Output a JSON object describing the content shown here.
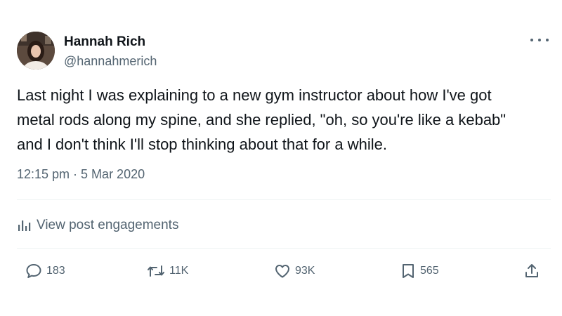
{
  "author": {
    "display_name": "Hannah Rich",
    "handle": "@hannahmerich"
  },
  "tweet": {
    "text_lines": [
      "Last night I was explaining to a new gym instructor about how I've got",
      "metal rods along my spine, and she replied, \"oh, so you're like a kebab\"",
      "and I don't think I'll stop thinking about that for a while."
    ],
    "timestamp": "12:15 pm · 5 Mar 2020"
  },
  "engagements": {
    "label": "View post engagements",
    "icon": "analytics-icon"
  },
  "actions": {
    "reply": {
      "icon": "reply-icon",
      "count": "183"
    },
    "repost": {
      "icon": "repost-icon",
      "count": "11K"
    },
    "like": {
      "icon": "like-icon",
      "count": "93K"
    },
    "bookmark": {
      "icon": "bookmark-icon",
      "count": "565"
    },
    "share": {
      "icon": "share-icon"
    }
  },
  "menu": {
    "icon": "more-icon"
  },
  "colors": {
    "text": "#0f1419",
    "secondary": "#536471",
    "divider": "#eff3f4",
    "background": "#ffffff"
  }
}
